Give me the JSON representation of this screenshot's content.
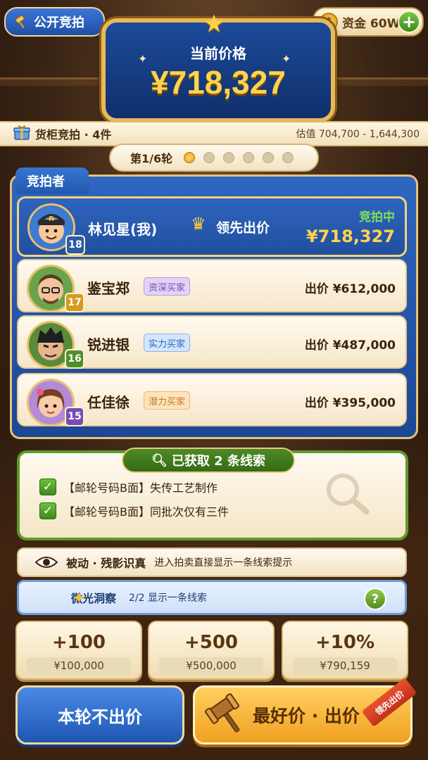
{
  "topbar": {
    "public_label": "公开竞拍",
    "funds_label": "资金 60W",
    "coin_symbol": "$",
    "plus_symbol": "+"
  },
  "price_plaque": {
    "label": "当前价格",
    "value": "¥718,327"
  },
  "lot": {
    "label": "货柜竞拍 · 4件",
    "estimate": "估值 704,700 - 1,644,300"
  },
  "round": {
    "label": "第1/6轮",
    "current": 1,
    "total": 6
  },
  "bidders_panel": {
    "title": "竞拍者",
    "me": {
      "name": "林见星(我)",
      "level": "18",
      "lead_label": "领先出价",
      "status": "竞拍中",
      "price": "¥718,327"
    },
    "others": [
      {
        "name": "鉴宝郑",
        "level": "17",
        "tag": "资深买家",
        "bid": "出价 ¥612,000"
      },
      {
        "name": "锐进银",
        "level": "16",
        "tag": "实力买家",
        "bid": "出价 ¥487,000"
      },
      {
        "name": "任佳徐",
        "level": "15",
        "tag": "潜力买家",
        "bid": "出价 ¥395,000"
      }
    ]
  },
  "clues": {
    "header": "已获取 2 条线索",
    "items": [
      "【邮轮号码B面】失传工艺制作",
      "【邮轮号码B面】同批次仅有三件"
    ]
  },
  "skills": {
    "passive_name": "被动 · 残影识真",
    "passive_desc": "进入拍卖直接显示一条线索提示",
    "active_name": "微光洞察",
    "active_desc": "2/2 显示一条线索",
    "help_symbol": "?"
  },
  "increments": [
    {
      "label": "+100",
      "sub": "¥100,000"
    },
    {
      "label": "+500",
      "sub": "¥500,000"
    },
    {
      "label": "+10%",
      "sub": "¥790,159"
    }
  ],
  "actions": {
    "pass_label": "本轮不出价",
    "best_label": "最好价 · 出价",
    "ribbon": "领先出价"
  },
  "colors": {
    "panel_blue": "#2e66c0",
    "gold": "#ffd34d",
    "clue_green": "#5e9a2c"
  }
}
